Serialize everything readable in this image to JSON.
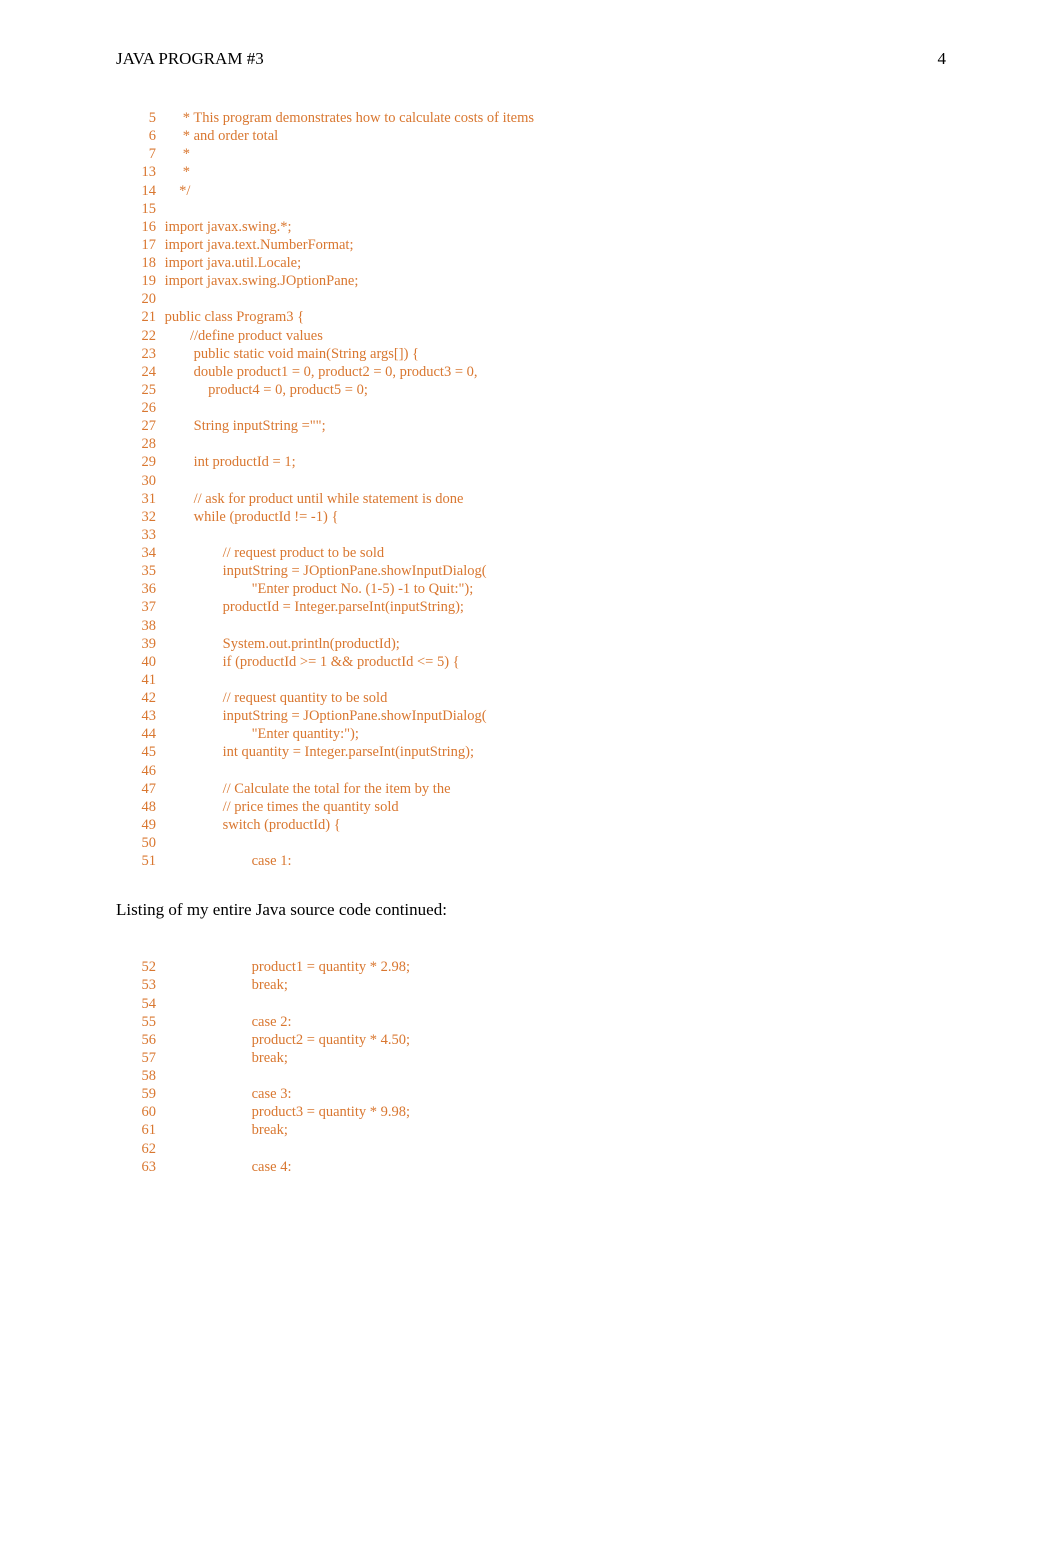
{
  "header": {
    "title": "JAVA PROGRAM #3",
    "page_number": "4"
  },
  "code_block_1": [
    {
      "num": "5",
      "text": "     * This program demonstrates how to calculate costs of items"
    },
    {
      "num": "6",
      "text": "     * and order total"
    },
    {
      "num": "7",
      "text": "     *"
    },
    {
      "num": "13",
      "text": "     *"
    },
    {
      "num": "14",
      "text": "    */"
    },
    {
      "num": "15",
      "text": ""
    },
    {
      "num": "16",
      "text": "import javax.swing.*;"
    },
    {
      "num": "17",
      "text": "import java.text.NumberFormat;"
    },
    {
      "num": "18",
      "text": "import java.util.Locale;"
    },
    {
      "num": "19",
      "text": "import javax.swing.JOptionPane;"
    },
    {
      "num": "20",
      "text": ""
    },
    {
      "num": "21",
      "text": "public class Program3 {"
    },
    {
      "num": "22",
      "text": "       //define product values"
    },
    {
      "num": "23",
      "text": "        public static void main(String args[]) {"
    },
    {
      "num": "24",
      "text": "        double product1 = 0, product2 = 0, product3 = 0,"
    },
    {
      "num": "25",
      "text": "            product4 = 0, product5 = 0;"
    },
    {
      "num": "26",
      "text": ""
    },
    {
      "num": "27",
      "text": "        String inputString =\"\";"
    },
    {
      "num": "28",
      "text": ""
    },
    {
      "num": "29",
      "text": "        int productId = 1;"
    },
    {
      "num": "30",
      "text": ""
    },
    {
      "num": "31",
      "text": "        // ask for product until while statement is done"
    },
    {
      "num": "32",
      "text": "        while (productId != -1) {"
    },
    {
      "num": "33",
      "text": ""
    },
    {
      "num": "34",
      "text": "                // request product to be sold"
    },
    {
      "num": "35",
      "text": "                inputString = JOptionPane.showInputDialog("
    },
    {
      "num": "36",
      "text": "                        \"Enter product No. (1-5) -1 to Quit:\");"
    },
    {
      "num": "37",
      "text": "                productId = Integer.parseInt(inputString);"
    },
    {
      "num": "38",
      "text": ""
    },
    {
      "num": "39",
      "text": "                System.out.println(productId);"
    },
    {
      "num": "40",
      "text": "                if (productId >= 1 && productId <= 5) {"
    },
    {
      "num": "41",
      "text": ""
    },
    {
      "num": "42",
      "text": "                // request quantity to be sold"
    },
    {
      "num": "43",
      "text": "                inputString = JOptionPane.showInputDialog("
    },
    {
      "num": "44",
      "text": "                        \"Enter quantity:\");"
    },
    {
      "num": "45",
      "text": "                int quantity = Integer.parseInt(inputString);"
    },
    {
      "num": "46",
      "text": ""
    },
    {
      "num": "47",
      "text": "                // Calculate the total for the item by the"
    },
    {
      "num": "48",
      "text": "                // price times the quantity sold"
    },
    {
      "num": "49",
      "text": "                switch (productId) {"
    },
    {
      "num": "50",
      "text": ""
    },
    {
      "num": "51",
      "text": "                        case 1:"
    }
  ],
  "section_label": "Listing of my entire Java source code continued:",
  "code_block_2": [
    {
      "num": "52",
      "text": "                        product1 = quantity * 2.98;"
    },
    {
      "num": "53",
      "text": "                        break;"
    },
    {
      "num": "54",
      "text": ""
    },
    {
      "num": "55",
      "text": "                        case 2:"
    },
    {
      "num": "56",
      "text": "                        product2 = quantity * 4.50;"
    },
    {
      "num": "57",
      "text": "                        break;"
    },
    {
      "num": "58",
      "text": ""
    },
    {
      "num": "59",
      "text": "                        case 3:"
    },
    {
      "num": "60",
      "text": "                        product3 = quantity * 9.98;"
    },
    {
      "num": "61",
      "text": "                        break;"
    },
    {
      "num": "62",
      "text": ""
    },
    {
      "num": "63",
      "text": "                        case 4:"
    }
  ]
}
